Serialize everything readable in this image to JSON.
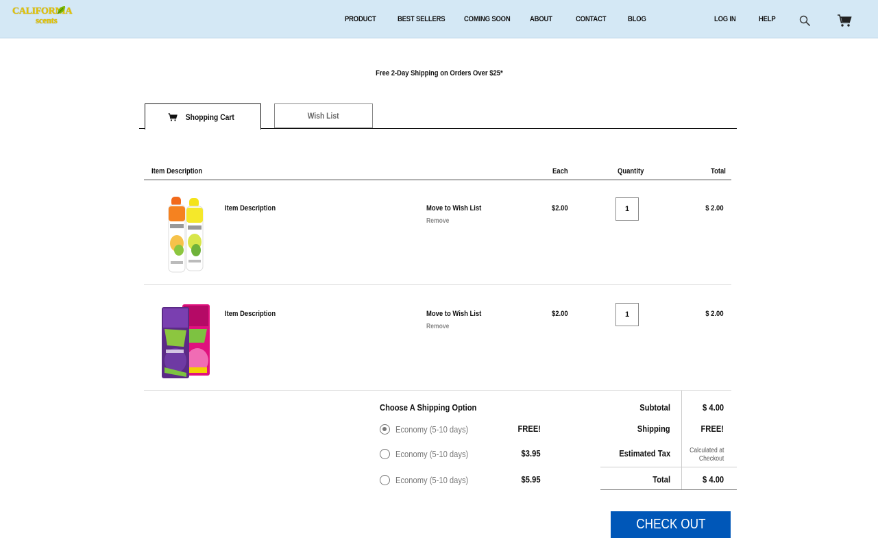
{
  "brand": {
    "line1": "CALIFORNIA",
    "line2": "scents"
  },
  "nav": {
    "product": "PRODUCT",
    "best_sellers": "BEST SELLERS",
    "coming_soon": "COMING SOON",
    "about": "ABOUT",
    "contact": "CONTACT",
    "blog": "BLOG",
    "login": "LOG IN",
    "help": "HELP"
  },
  "promo": "Free 2-Day Shipping on Orders Over $25*",
  "tabs": {
    "cart": "Shopping Cart",
    "wishlist": "Wish List"
  },
  "table": {
    "headers": {
      "description": "Item Description",
      "each": "Each",
      "quantity": "Quantity",
      "total": "Total"
    },
    "rows": [
      {
        "description": "Item Description",
        "move": "Move to Wish List",
        "remove": "Remove",
        "each": "$2.00",
        "quantity": "1",
        "total": "$ 2.00"
      },
      {
        "description": "Item Description",
        "move": "Move to Wish List",
        "remove": "Remove",
        "each": "$2.00",
        "quantity": "1",
        "total": "$ 2.00"
      }
    ]
  },
  "shipping": {
    "title": "Choose A Shipping Option",
    "options": [
      {
        "label": "Economy (5-10 days)",
        "price": "FREE!",
        "selected": true
      },
      {
        "label": "Economy (5-10 days)",
        "price": "$3.95",
        "selected": false
      },
      {
        "label": "Economy (5-10 days)",
        "price": "$5.95",
        "selected": false
      }
    ]
  },
  "summary": {
    "subtotal_label": "Subtotal",
    "subtotal_value": "$ 4.00",
    "shipping_label": "Shipping",
    "shipping_value": "FREE!",
    "tax_label": "Estimated Tax",
    "tax_note_line1": "Calculated at",
    "tax_note_line2": "Checkout",
    "total_label": "Total",
    "total_value": "$ 4.00"
  },
  "checkout_label": "CHECK OUT",
  "colors": {
    "header_bg": "#d4e8f5",
    "checkout_bg": "#0057b8",
    "logo": "#e5c400"
  },
  "icons": [
    "search-icon",
    "cart-icon",
    "leaf-icon",
    "radio-icon"
  ]
}
